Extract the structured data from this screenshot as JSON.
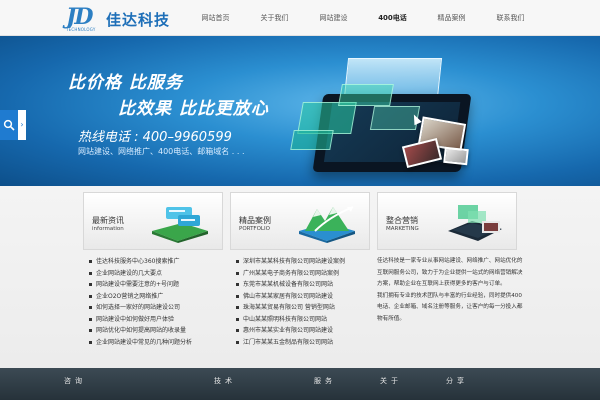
{
  "header": {
    "logo_mark": "JD",
    "logo_tagline": "TECHNOLOGY",
    "logo_text": "佳达科技"
  },
  "nav": [
    {
      "label": "网站首页"
    },
    {
      "label": "关于我们"
    },
    {
      "label": "网站建设"
    },
    {
      "label": "400电话"
    },
    {
      "label": "精品案例"
    },
    {
      "label": "联系我们"
    }
  ],
  "banner": {
    "line1": "比价格  比服务",
    "line2": "比效果  比比更放心",
    "phone": "热线电话 : 400–9960599",
    "services": "网站建设、网络推广、400电话、邮箱域名 . . ."
  },
  "columns": {
    "news": {
      "title": "最新资讯",
      "subtitle": "information",
      "items": [
        "佳达科技服务中心360搜索推广",
        "企业网站建设的几大要点",
        "网站建设中需要注意的+号问题",
        "企业O2O营销之网络推广",
        "如何选择一家好的网站建设公司",
        "网站建设中如何做好用户体验",
        "网站优化中如何提高网站的收录量",
        "企业网站建设中常见的几种问题分析"
      ]
    },
    "cases": {
      "title": "精品案例",
      "subtitle": "PORTFOLIO",
      "items": [
        "深圳市某某科技有限公司网站建设案例",
        "广州某某电子商务有限公司网站案例",
        "东莞市某某机械设备有限公司网站",
        "佛山市某某家居有限公司网站建设",
        "珠海某某贸易有限公司 营销型网站",
        "中山某某照明科技有限公司网站",
        "惠州市某某实业有限公司网站建设",
        "江门市某某五金制品有限公司网站"
      ]
    },
    "marketing": {
      "title": "整合营销",
      "subtitle": "MARKETING",
      "paragraph1": "佳达科技是一家专业从事网站建设、网络推广、网站优化的互联网服务公司，致力于为企业提供一站式的网络营销解决方案，帮助企业在互联网上获得更多的客户与订单。",
      "paragraph2": "我们拥有专业的技术团队与丰富的行业经验，同时提供400电话、企业邮箱、域名注册等服务，让客户的每一分投入都物有所值。"
    }
  },
  "footer": [
    {
      "label": "咨询"
    },
    {
      "label": "技术"
    },
    {
      "label": "服务"
    },
    {
      "label": "关于"
    },
    {
      "label": "分享"
    }
  ],
  "colors": {
    "brand_blue": "#1e6fb8",
    "banner_blue": "#2b8fd1",
    "footer_dark": "#2f3c45"
  },
  "icons": {
    "search": "search-icon",
    "arrow": "chevron-right-icon"
  }
}
